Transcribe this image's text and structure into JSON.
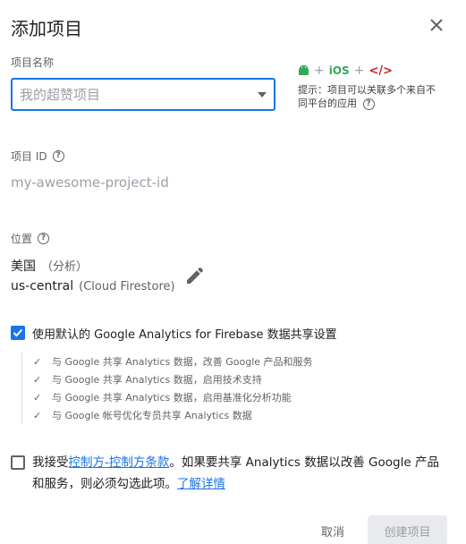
{
  "dialog": {
    "title": "添加项目"
  },
  "project_name": {
    "label": "项目名称",
    "placeholder": "我的超赞项目"
  },
  "platforms": {
    "plus": "+",
    "ios": "iOS",
    "web": "</>",
    "tip": "提示：项目可以关联多个来自不同平台的应用"
  },
  "project_id": {
    "label": "项目 ID",
    "value": "my-awesome-project-id"
  },
  "location": {
    "label": "位置",
    "country": "美国",
    "country_note": "（分析）",
    "region": "us-central",
    "region_note": "(Cloud Firestore)"
  },
  "analytics": {
    "label": "使用默认的 Google Analytics for Firebase 数据共享设置",
    "checked": true,
    "items": [
      "与 Google 共享 Analytics 数据，改善 Google 产品和服务",
      "与 Google 共享 Analytics 数据，启用技术支持",
      "与 Google 共享 Analytics 数据，启用基准化分析功能",
      "与 Google 帐号优化专员共享 Analytics 数据"
    ]
  },
  "terms": {
    "checked": false,
    "prefix": "我接受",
    "link": "控制方-控制方条款",
    "middle": "。如果要共享 Analytics 数据以改善 Google 产品和服务，则必须勾选此项。",
    "learn_more": "了解详情"
  },
  "buttons": {
    "cancel": "取消",
    "create": "创建项目"
  },
  "colors": {
    "accent": "#1a73e8",
    "android": "#34a853",
    "web": "#c5221f"
  }
}
